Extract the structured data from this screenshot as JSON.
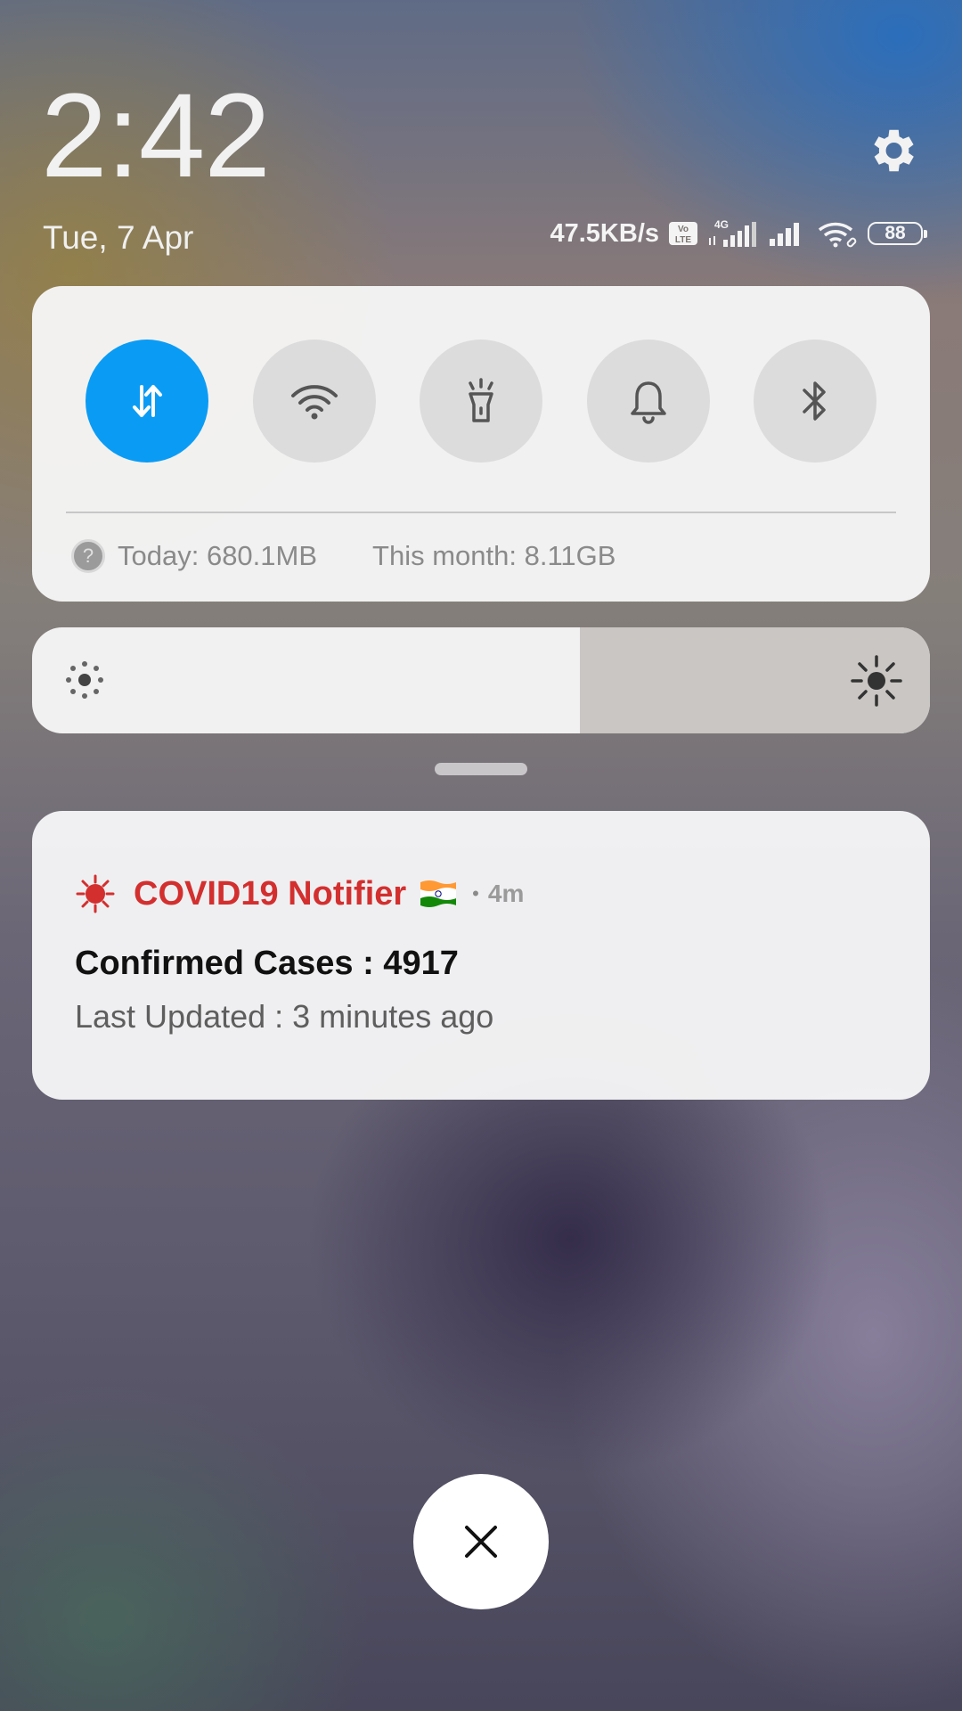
{
  "lockscreen": {
    "time": "2:42",
    "date": "Tue, 7 Apr"
  },
  "status_bar": {
    "network_speed": "47.5KB/s",
    "volte_label": "Vo LTE",
    "network_type": "4G",
    "battery_level": "88",
    "icons": [
      "volte-icon",
      "signal-4g-icon",
      "signal-icon",
      "wifi-icon",
      "battery-icon"
    ]
  },
  "quick_settings": {
    "toggles": [
      {
        "name": "mobile-data",
        "icon": "mobile-data-icon",
        "state": "on"
      },
      {
        "name": "wifi",
        "icon": "wifi-icon",
        "state": "off"
      },
      {
        "name": "flashlight",
        "icon": "flashlight-icon",
        "state": "off"
      },
      {
        "name": "sound",
        "icon": "bell-icon",
        "state": "off"
      },
      {
        "name": "bluetooth",
        "icon": "bluetooth-icon",
        "state": "off"
      }
    ],
    "data_usage": {
      "today": "Today: 680.1MB",
      "month": "This month: 8.11GB"
    },
    "active_color": "#0a9cf5"
  },
  "brightness": {
    "level": 0.61
  },
  "notification": {
    "app_name": "COVID19 Notifier",
    "app_name_color": "#d32f2f",
    "time_ago": "4m",
    "separator": "•",
    "title": "Confirmed Cases : 4917",
    "text": "Last Updated : 3 minutes ago"
  }
}
